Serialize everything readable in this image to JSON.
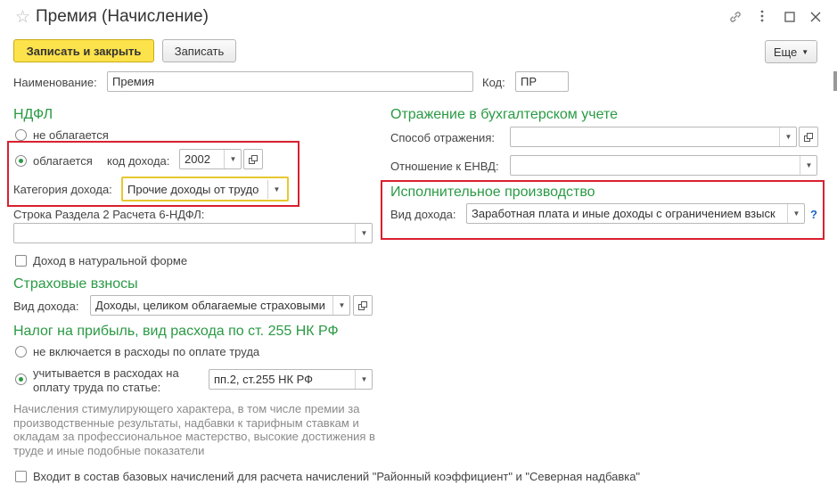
{
  "window": {
    "title": "Премия (Начисление)",
    "controls": {
      "link_icon": "link-icon",
      "menu_icon": "more-vertical-icon",
      "maximize_icon": "maximize-icon",
      "close_icon": "close-icon"
    }
  },
  "toolbar": {
    "save_close_label": "Записать и закрыть",
    "save_label": "Записать",
    "more_label": "Еще"
  },
  "header": {
    "name_label": "Наименование:",
    "name_value": "Премия",
    "code_label": "Код:",
    "code_value": "ПР"
  },
  "ndfl": {
    "section_title": "НДФЛ",
    "not_taxed_label": "не облагается",
    "taxed_label": "облагается",
    "income_code_label": "код дохода:",
    "income_code_value": "2002",
    "category_label": "Категория дохода:",
    "category_value": "Прочие доходы от трудо",
    "line_label": "Строка Раздела 2 Расчета 6-НДФЛ:",
    "line_value": "",
    "natural_label": "Доход в натуральной форме",
    "selected": "taxed"
  },
  "insurance": {
    "section_title": "Страховые взносы",
    "income_type_label": "Вид дохода:",
    "income_type_value": "Доходы, целиком облагаемые страховыми"
  },
  "profit_tax": {
    "section_title": "Налог на прибыль, вид расхода по ст. 255 НК РФ",
    "not_included_label": "не включается в расходы по оплате труда",
    "included_label_line1": "учитывается в расходах на",
    "included_label_line2": "оплату труда по статье:",
    "article_value": "пп.2, ст.255 НК РФ",
    "selected": "included",
    "note": "Начисления стимулирующего характера, в том числе премии за производственные результаты, надбавки к тарифным ставкам и окладам за профессиональное мастерство, высокие достижения в труде и иные подобные показатели"
  },
  "accounting": {
    "section_title": "Отражение в бухгалтерском учете",
    "method_label": "Способ отражения:",
    "method_value": "",
    "envd_label": "Отношение к ЕНВД:",
    "envd_value": ""
  },
  "enforcement": {
    "section_title": "Исполнительное производство",
    "income_type_label": "Вид дохода:",
    "income_type_value": "Заработная плата и иные доходы с ограничением взыск",
    "help": "?"
  },
  "footer": {
    "base_accruals_label": "Входит в состав базовых начислений для расчета начислений \"Районный коэффициент\" и \"Северная надбавка\""
  },
  "colors": {
    "accent_green": "#2a9a44",
    "primary_yellow": "#fce24b",
    "highlight_red": "#d9202e",
    "highlight_yellow": "#e8c830",
    "help_blue": "#1a64c8"
  }
}
